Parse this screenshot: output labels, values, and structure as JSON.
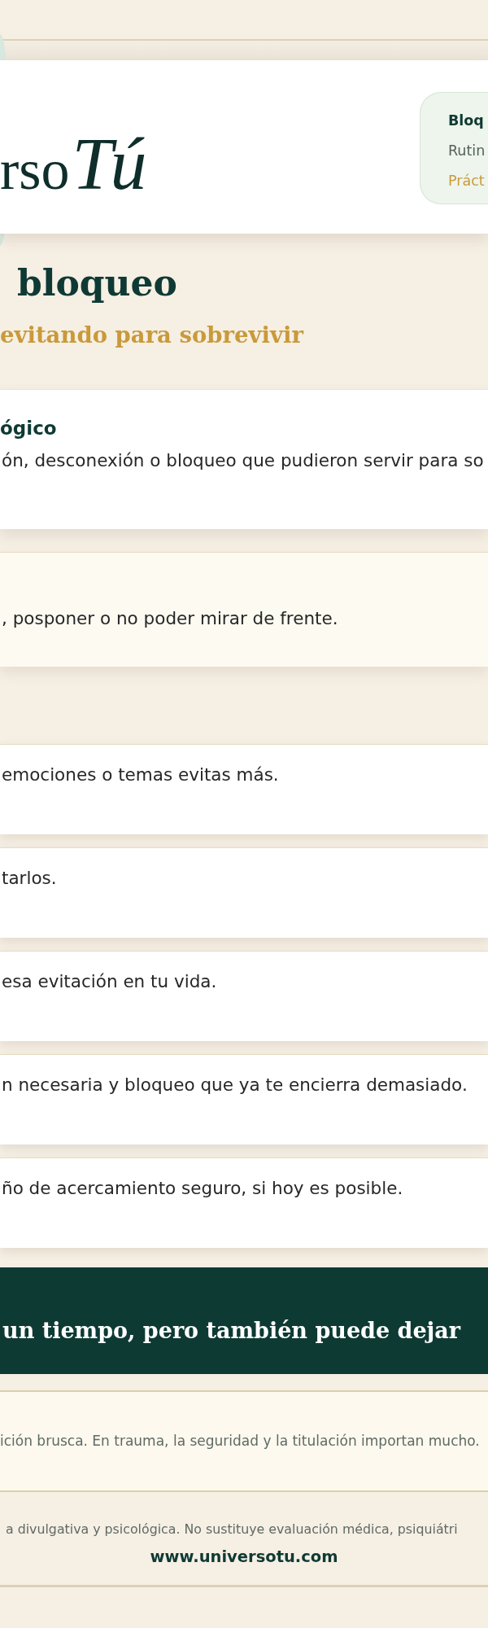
{
  "header": {
    "logo": {
      "wordmark": "rso",
      "script": "Tú"
    },
    "summary": {
      "title": "Bloq",
      "subtitle": "Rutin",
      "tag": "Práct"
    }
  },
  "hero": {
    "title": "bloqueo",
    "subtitle": "evitando para sobrevivir"
  },
  "cards": [
    {
      "kind": "info",
      "heading": "ógico",
      "text": "ón, desconexión o bloqueo que pudieron servir para so"
    },
    {
      "kind": "note",
      "text": ", posponer o no poder mirar de frente."
    }
  ],
  "steps": [
    {
      "text": "emociones o temas evitas más."
    },
    {
      "text": "tarlos."
    },
    {
      "text": "esa evitación en tu vida."
    },
    {
      "text": "n necesaria y bloqueo que ya te encierra demasiado."
    },
    {
      "text": "ño de acercamiento seguro, si hoy es posible."
    }
  ],
  "quote": {
    "text": "un tiempo, pero también puede dejar"
  },
  "caution": {
    "text": "ición brusca. En trauma, la seguridad y la titulación importan mucho."
  },
  "footer": {
    "disclaimer": "a divulgativa y psicológica. No sustituye evaluación médica, psiquiátri",
    "url": "www.universotu.com"
  }
}
